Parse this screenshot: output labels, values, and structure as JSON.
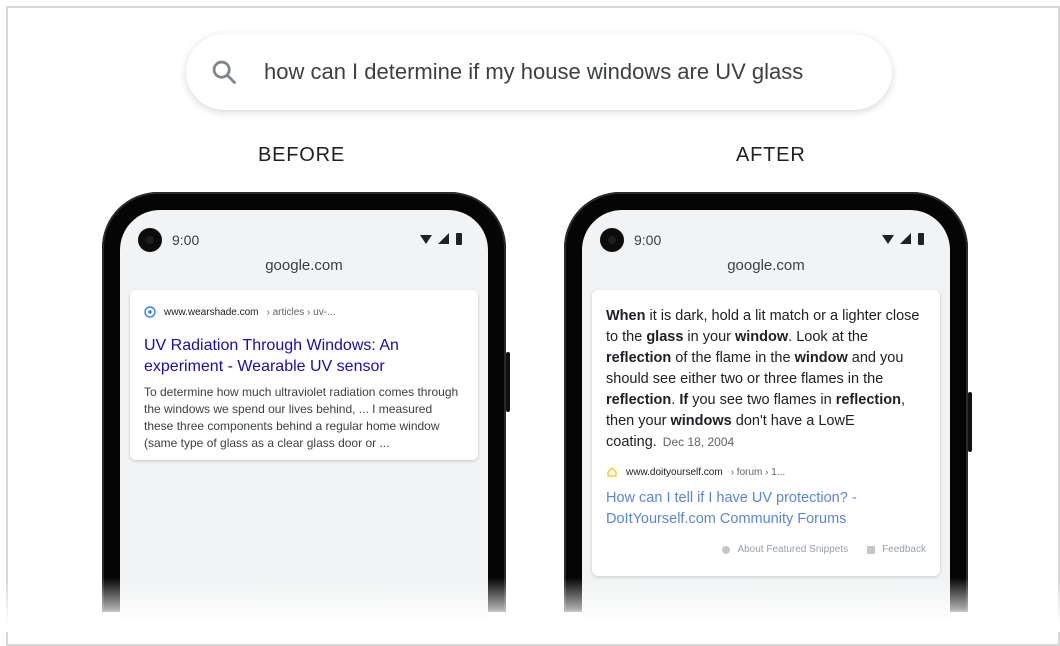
{
  "search": {
    "query": "how can I determine if my house windows are UV glass"
  },
  "labels": {
    "before": "BEFORE",
    "after": "AFTER"
  },
  "phones": {
    "before": {
      "time": "9:00",
      "url": "google.com",
      "result": {
        "site": "www.wearshade.com",
        "crumbs": "› articles › uv-...",
        "title": "UV Radiation Through Windows: An experiment - Wearable UV sensor",
        "snippet": "To determine how much ultraviolet radiation comes through the windows we spend our lives behind, ... I measured these three components behind a regular home window (same type of glass as a clear glass door or  ..."
      }
    },
    "after": {
      "time": "9:00",
      "url": "google.com",
      "featured": {
        "part1_bold": "When",
        "part1": " it is dark, hold a lit match or a lighter close to the ",
        "part2_bold": "glass",
        "part2": " in your ",
        "part3_bold": "window",
        "part3": ". Look at the ",
        "part4_bold": "reflection",
        "part4": " of the flame in the ",
        "part5_bold": "window",
        "part5": " and you should see either two or three flames in the ",
        "part6_bold": "reflection",
        "part6": ". ",
        "part7_bold": "If",
        "part7": " you see two flames in ",
        "part8_bold": "reflection",
        "part8": ", then your ",
        "part9_bold": "windows",
        "part9": " don't have a LowE coating.",
        "date": "Dec 18, 2004"
      },
      "source": {
        "site": "www.doityourself.com",
        "crumbs": "› forum › 1...",
        "title": "How can I tell if I have UV protection? - DoItYourself.com Community Forums"
      },
      "footer": {
        "about": "About Featured Snippets",
        "feedback": "Feedback"
      }
    }
  }
}
